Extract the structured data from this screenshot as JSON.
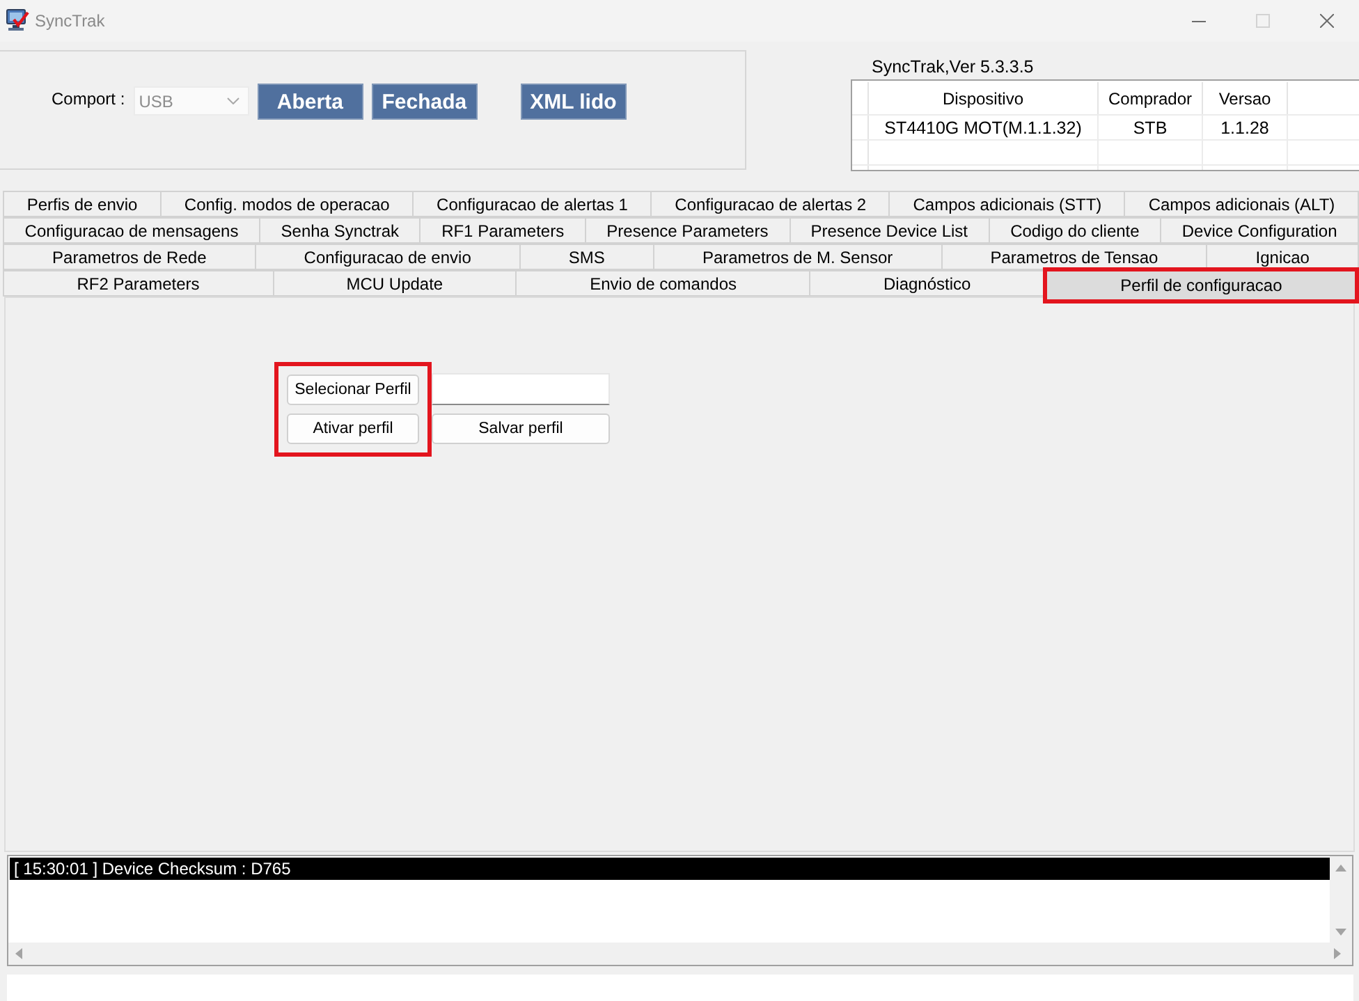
{
  "window": {
    "title": "SyncTrak",
    "controls": [
      {
        "kind": "minimize",
        "disabled": false
      },
      {
        "kind": "maximize",
        "disabled": true
      },
      {
        "kind": "close",
        "disabled": false
      }
    ]
  },
  "connection": {
    "comport_label": "Comport :",
    "comport": {
      "value": "USB",
      "disabled": true
    },
    "buttons": [
      "Aberta",
      "Fechada"
    ],
    "xml_button": "XML lido"
  },
  "device_info": {
    "version": "SyncTrak,Ver 5.3.3.5",
    "columns": [
      "Dispositivo",
      "Comprador",
      "Versao"
    ],
    "rows": [
      [
        "ST4410G MOT(M.1.1.32)",
        "STB",
        "1.1.28"
      ]
    ]
  },
  "tab_rows": [
    [
      {
        "label": "Perfis de envio",
        "selected": false,
        "highlighted": false
      },
      {
        "label": "Config. modos de operacao",
        "selected": false,
        "highlighted": false
      },
      {
        "label": "Configuracao de alertas 1",
        "selected": false,
        "highlighted": false
      },
      {
        "label": "Configuracao de alertas 2",
        "selected": false,
        "highlighted": false
      },
      {
        "label": "Campos adicionais (STT)",
        "selected": false,
        "highlighted": false
      },
      {
        "label": "Campos adicionais (ALT)",
        "selected": false,
        "highlighted": false
      }
    ],
    [
      {
        "label": "Configuracao de mensagens",
        "selected": false,
        "highlighted": false
      },
      {
        "label": "Senha Synctrak",
        "selected": false,
        "highlighted": false
      },
      {
        "label": "RF1 Parameters",
        "selected": false,
        "highlighted": false
      },
      {
        "label": "Presence Parameters",
        "selected": false,
        "highlighted": false
      },
      {
        "label": "Presence Device List",
        "selected": false,
        "highlighted": false
      },
      {
        "label": "Codigo do cliente",
        "selected": false,
        "highlighted": false
      },
      {
        "label": "Device Configuration",
        "selected": false,
        "highlighted": false
      }
    ],
    [
      {
        "label": "Parametros de Rede",
        "selected": false,
        "highlighted": false
      },
      {
        "label": "Configuracao de envio",
        "selected": false,
        "highlighted": false
      },
      {
        "label": "SMS",
        "selected": false,
        "highlighted": false
      },
      {
        "label": "Parametros de M. Sensor",
        "selected": false,
        "highlighted": false
      },
      {
        "label": "Parametros de Tensao",
        "selected": false,
        "highlighted": false
      },
      {
        "label": "Ignicao",
        "selected": false,
        "highlighted": false
      }
    ],
    [
      {
        "label": "RF2 Parameters",
        "selected": false,
        "highlighted": false
      },
      {
        "label": "MCU Update",
        "selected": false,
        "highlighted": false
      },
      {
        "label": "Envio de comandos",
        "selected": false,
        "highlighted": false
      },
      {
        "label": "Diagnóstico",
        "selected": false,
        "highlighted": false
      },
      {
        "label": "Perfil de configuracao",
        "selected": true,
        "highlighted": true
      }
    ]
  ],
  "profile_form": {
    "highlighted": true,
    "select_button": "Selecionar Perfil",
    "activate_button": "Ativar perfil",
    "save_button": "Salvar perfil"
  },
  "log": {
    "lines": [
      {
        "text": "[ 15:30:01 ] Device Checksum : D765",
        "selected": true
      }
    ]
  }
}
